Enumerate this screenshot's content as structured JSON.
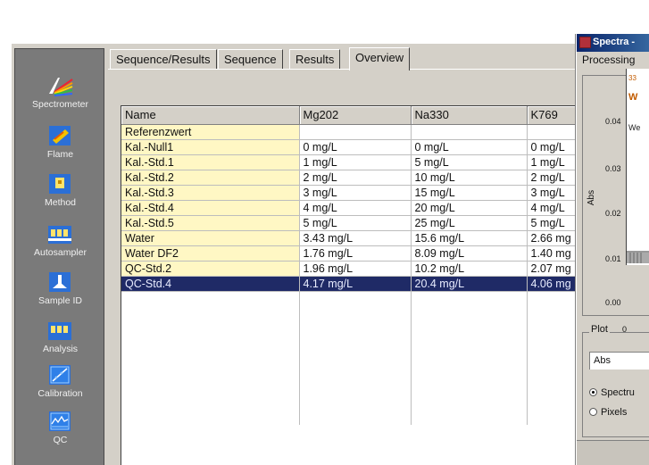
{
  "sidebar": {
    "items": [
      {
        "label": "Spectrometer",
        "icon": "spectrometer-icon"
      },
      {
        "label": "Flame",
        "icon": "flame-icon"
      },
      {
        "label": "Method",
        "icon": "method-icon"
      },
      {
        "label": "Autosampler",
        "icon": "autosampler-icon"
      },
      {
        "label": "Sample ID",
        "icon": "sample-id-icon"
      },
      {
        "label": "Analysis",
        "icon": "analysis-icon"
      },
      {
        "label": "Calibration",
        "icon": "calibration-icon"
      },
      {
        "label": "QC",
        "icon": "qc-icon"
      }
    ]
  },
  "tabs": [
    "Sequence/Results",
    "Sequence",
    "Results",
    "Overview"
  ],
  "active_tab": "Overview",
  "table": {
    "headers": [
      "Name",
      "Mg202",
      "Na330",
      "K769"
    ],
    "rows": [
      [
        "Referenzwert",
        "",
        "",
        ""
      ],
      [
        "Kal.-Null1",
        "0 mg/L",
        "0 mg/L",
        "0 mg/L"
      ],
      [
        "Kal.-Std.1",
        "1 mg/L",
        "5 mg/L",
        "1 mg/L"
      ],
      [
        "Kal.-Std.2",
        "2 mg/L",
        "10 mg/L",
        "2 mg/L"
      ],
      [
        "Kal.-Std.3",
        "3 mg/L",
        "15 mg/L",
        "3 mg/L"
      ],
      [
        "Kal.-Std.4",
        "4 mg/L",
        "20 mg/L",
        "4 mg/L"
      ],
      [
        "Kal.-Std.5",
        "5 mg/L",
        "25 mg/L",
        "5 mg/L"
      ],
      [
        "Water",
        "3.43 mg/L",
        "15.6 mg/L",
        "2.66 mg"
      ],
      [
        "Water DF2",
        "1.76 mg/L",
        "8.09 mg/L",
        "1.40 mg"
      ],
      [
        "QC-Std.2",
        "1.96 mg/L",
        "10.2 mg/L",
        "2.07 mg"
      ],
      [
        "QC-Std.4",
        "4.17 mg/L",
        "20.4 mg/L",
        "4.06 mg"
      ]
    ],
    "selected_row": 10
  },
  "spectra": {
    "title": "Spectra -",
    "menu": "Processing",
    "y_axis_label": "Abs",
    "y_ticks": [
      "0.04",
      "0.03",
      "0.02",
      "0.01",
      "0.00"
    ],
    "x_tick": "0",
    "legend_line1": "33",
    "legend_line2": "W",
    "legend_line3": "We",
    "plot_group_label": "Plot",
    "plot_select_value": "Abs",
    "radio_spectrum": "Spectru",
    "radio_pixels": "Pixels"
  },
  "colors": {
    "selection": "#1f2a66",
    "name_column": "#fff7c4",
    "sidebar": "#7a7a7a",
    "titlebar": "#0a246a"
  }
}
